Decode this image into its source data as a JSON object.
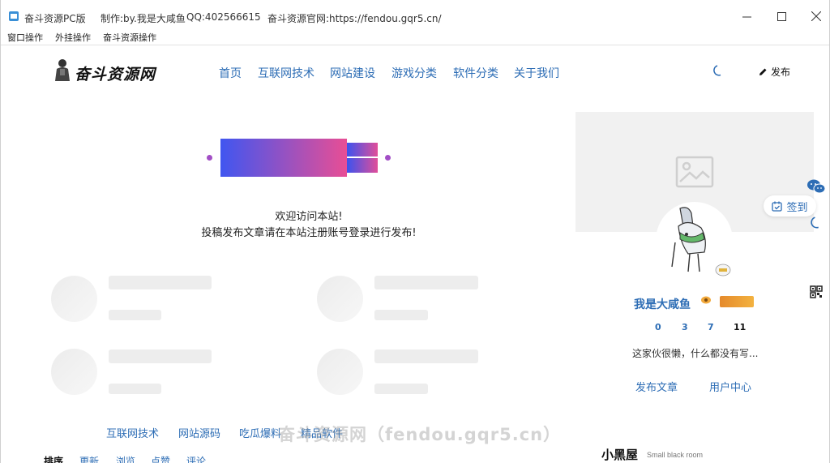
{
  "window": {
    "title": "奋斗资源PC版",
    "author": "制作:by.我是大咸鱼",
    "qq": "QQ:402566615",
    "official": "奋斗资源官网:https://fendou.gqr5.cn/",
    "controls": [
      "minimize",
      "maximize",
      "close"
    ]
  },
  "menu": [
    "窗口操作",
    "外挂操作",
    "奋斗资源操作"
  ],
  "site": {
    "logo_text": "奋斗资源网",
    "nav": [
      "首页",
      "互联网技术",
      "网站建设",
      "游戏分类",
      "软件分类",
      "关于我们"
    ],
    "publish_label": "发布"
  },
  "welcome": {
    "line1": "欢迎访问本站!",
    "line2": "投稿发布文章请在本站注册账号登录进行发布!"
  },
  "bottom_links": [
    "互联网技术",
    "网站源码",
    "吃瓜爆料",
    "精品软件"
  ],
  "sort_tabs": [
    "排序",
    "更新",
    "浏览",
    "点赞",
    "评论"
  ],
  "watermark": "奋斗资源网（fendou.gqr5.cn）",
  "profile": {
    "name": "我是大咸鱼",
    "stats": [
      "0",
      "3",
      "7",
      "11"
    ],
    "bio": "这家伙很懒，什么都没有写...",
    "publish_link": "发布文章",
    "center_link": "用户中心"
  },
  "sidebar_box": {
    "title": "小黑屋",
    "subtitle": "Small black room"
  },
  "floating": {
    "signin_label": "签到"
  },
  "colors": {
    "link": "#2d6db5",
    "banner_start": "#4056f0",
    "banner_end": "#e84e95"
  }
}
